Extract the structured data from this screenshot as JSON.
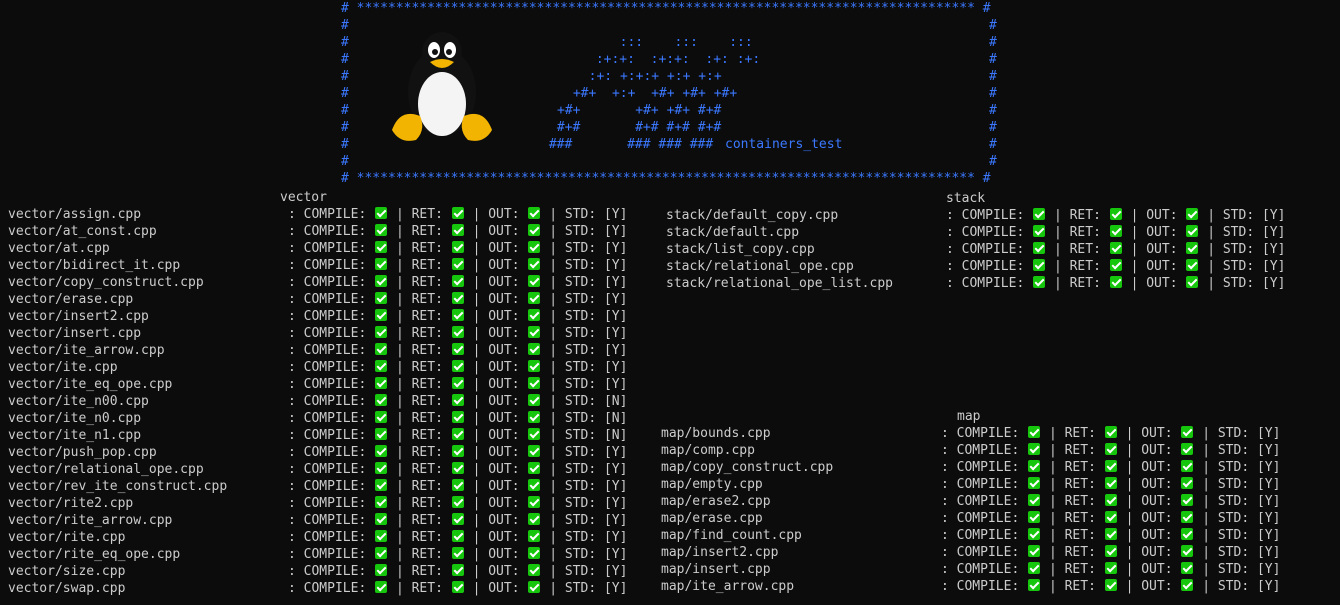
{
  "banner": {
    "top_border": "# ******************************************************************************* #",
    "bottom_border": "# ******************************************************************************* #",
    "side": "#",
    "art": [
      "  :::    :::    :::",
      " :+:+:  :+:+:  :+: :+:",
      "  :+: +:+:+ +:+ +:+",
      " +#+  +:+  +#+ +#+ +#+",
      "+#+       +#+ +#+ #+#",
      " #+#       #+# #+# #+#",
      " ###       ### ### ###"
    ],
    "title": "containers_test"
  },
  "labels": {
    "compile": ": COMPILE:",
    "ret": "| RET:",
    "out": "| OUT:",
    "std": "| STD:"
  },
  "sections": {
    "vector": {
      "title": "vector",
      "tests": [
        {
          "name": "vector/assign.cpp",
          "std": "[Y]"
        },
        {
          "name": "vector/at_const.cpp",
          "std": "[Y]"
        },
        {
          "name": "vector/at.cpp",
          "std": "[Y]"
        },
        {
          "name": "vector/bidirect_it.cpp",
          "std": "[Y]"
        },
        {
          "name": "vector/copy_construct.cpp",
          "std": "[Y]"
        },
        {
          "name": "vector/erase.cpp",
          "std": "[Y]"
        },
        {
          "name": "vector/insert2.cpp",
          "std": "[Y]"
        },
        {
          "name": "vector/insert.cpp",
          "std": "[Y]"
        },
        {
          "name": "vector/ite_arrow.cpp",
          "std": "[Y]"
        },
        {
          "name": "vector/ite.cpp",
          "std": "[Y]"
        },
        {
          "name": "vector/ite_eq_ope.cpp",
          "std": "[Y]"
        },
        {
          "name": "vector/ite_n00.cpp",
          "std": "[N]"
        },
        {
          "name": "vector/ite_n0.cpp",
          "std": "[N]"
        },
        {
          "name": "vector/ite_n1.cpp",
          "std": "[N]"
        },
        {
          "name": "vector/push_pop.cpp",
          "std": "[Y]"
        },
        {
          "name": "vector/relational_ope.cpp",
          "std": "[Y]"
        },
        {
          "name": "vector/rev_ite_construct.cpp",
          "std": "[Y]"
        },
        {
          "name": "vector/rite2.cpp",
          "std": "[Y]"
        },
        {
          "name": "vector/rite_arrow.cpp",
          "std": "[Y]"
        },
        {
          "name": "vector/rite.cpp",
          "std": "[Y]"
        },
        {
          "name": "vector/rite_eq_ope.cpp",
          "std": "[Y]"
        },
        {
          "name": "vector/size.cpp",
          "std": "[Y]"
        },
        {
          "name": "vector/swap.cpp",
          "std": "[Y]"
        }
      ]
    },
    "stack": {
      "title": "stack",
      "tests": [
        {
          "name": "stack/default_copy.cpp",
          "std": "[Y]"
        },
        {
          "name": "stack/default.cpp",
          "std": "[Y]"
        },
        {
          "name": "stack/list_copy.cpp",
          "std": "[Y]"
        },
        {
          "name": "stack/relational_ope.cpp",
          "std": "[Y]"
        },
        {
          "name": "stack/relational_ope_list.cpp",
          "std": "[Y]"
        }
      ]
    },
    "map": {
      "title": "map",
      "tests": [
        {
          "name": "map/bounds.cpp",
          "std": "[Y]"
        },
        {
          "name": "map/comp.cpp",
          "std": "[Y]"
        },
        {
          "name": "map/copy_construct.cpp",
          "std": "[Y]"
        },
        {
          "name": "map/empty.cpp",
          "std": "[Y]"
        },
        {
          "name": "map/erase2.cpp",
          "std": "[Y]"
        },
        {
          "name": "map/erase.cpp",
          "std": "[Y]"
        },
        {
          "name": "map/find_count.cpp",
          "std": "[Y]"
        },
        {
          "name": "map/insert2.cpp",
          "std": "[Y]"
        },
        {
          "name": "map/insert.cpp",
          "std": "[Y]"
        },
        {
          "name": "map/ite_arrow.cpp",
          "std": "[Y]"
        }
      ]
    }
  },
  "colors": {
    "background": "#0c0c0c",
    "text": "#cccccc",
    "banner": "#3b78ff",
    "check": "#16c60c"
  },
  "icons": {
    "logo": "tux-penguin-icon",
    "pass": "green-checkmark-icon"
  }
}
